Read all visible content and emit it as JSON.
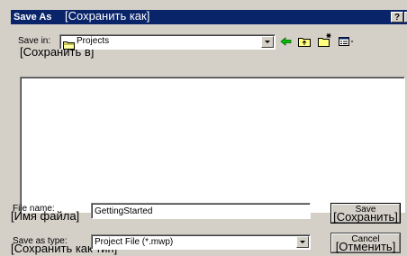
{
  "dialog": {
    "title": "Save As",
    "title_ru": "[Сохранить как]",
    "help_label": "?",
    "close_label": "✕"
  },
  "save_in": {
    "label": "Save in:",
    "label_ru": "[Сохранить в]",
    "value": "Projects"
  },
  "toolbar": {
    "back_icon": "back-arrow-icon",
    "up_icon": "up-folder-icon",
    "new_folder_icon": "new-folder-icon",
    "view_icon": "view-menu-icon"
  },
  "file_name": {
    "label": "File name:",
    "label_ru": "[Имя файла]",
    "value": "GettingStarted"
  },
  "save_as_type": {
    "label": "Save as type:",
    "label_ru": "[Сохранить как тип]",
    "value": "Project File (*.mwp)"
  },
  "buttons": {
    "save": "Save",
    "save_ru": "[Сохранить]",
    "cancel": "Cancel",
    "cancel_ru": "[Отменить]"
  },
  "colors": {
    "titlebar": "#0a246a",
    "dialog_face": "#d4d0c8"
  }
}
